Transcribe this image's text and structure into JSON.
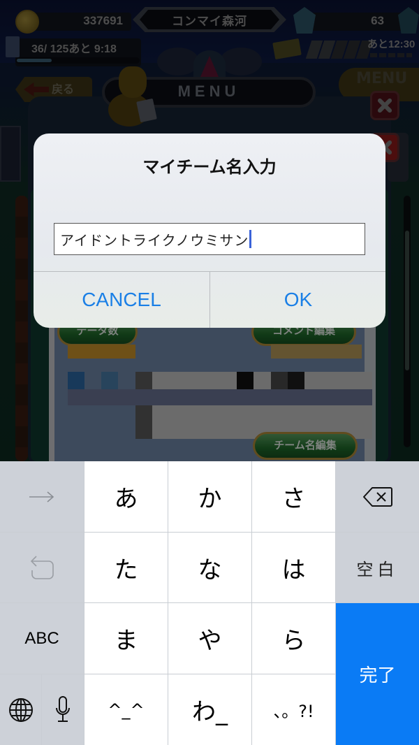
{
  "game": {
    "coins": "337691",
    "player_name": "コンマイ森河",
    "gems": "63",
    "stamina_text": "36/ 125あと  9:18",
    "stamina_ratio": 0.29,
    "bp_timer": "あと12:30",
    "back_label": "戻る",
    "menu_title": "MENU",
    "menu_right_label": "MENU",
    "card_button_left": "データ数",
    "card_button_right": "コメント編集",
    "card_button_team": "チーム名編集"
  },
  "dialog": {
    "title": "マイチーム名入力",
    "input_value": "アイドントライクノウミサン",
    "cancel_label": "CANCEL",
    "ok_label": "OK"
  },
  "keyboard": {
    "row1": {
      "left_icon": "arrow-right-icon",
      "keys": [
        "あ",
        "か",
        "さ"
      ],
      "right_icon": "delete-icon"
    },
    "row2": {
      "left_icon": "undo-icon",
      "keys": [
        "た",
        "な",
        "は"
      ],
      "right_label": "空白"
    },
    "row3": {
      "left_label": "ABC",
      "keys": [
        "ま",
        "や",
        "ら"
      ]
    },
    "row4": {
      "left_icons": [
        "globe-icon",
        "microphone-icon"
      ],
      "keys": [
        "^_^",
        "わ_",
        "、。?!"
      ]
    },
    "done_label": "完了",
    "accent_color": "#0a7bf5"
  }
}
